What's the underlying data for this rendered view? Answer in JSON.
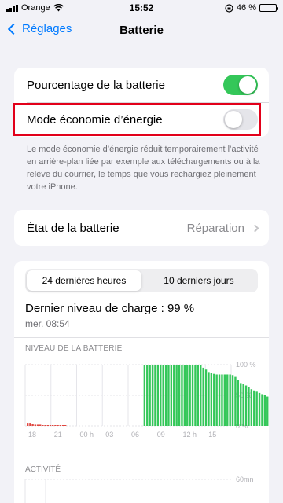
{
  "status_bar": {
    "carrier": "Orange",
    "time": "15:52",
    "battery_percent": "46 %",
    "battery_level": 0.46
  },
  "nav": {
    "back_label": "Réglages",
    "title": "Batterie"
  },
  "settings": {
    "battery_percentage": {
      "label": "Pourcentage de la batterie",
      "on": true
    },
    "low_power_mode": {
      "label": "Mode économie d’énergie",
      "on": false
    },
    "footnote": "Le mode économie d’énergie réduit temporairement l’activité en arrière-plan liée par exemple aux téléchargements ou à la relève du courrier, le temps que vous rechargiez pleinement votre iPhone."
  },
  "battery_state": {
    "label": "État de la batterie",
    "value": "Réparation"
  },
  "usage": {
    "tabs": [
      "24 dernières heures",
      "10 derniers jours"
    ],
    "active_tab": 0,
    "last_charge": "Dernier niveau de charge : 99 %",
    "last_charge_time": "mer. 08:54",
    "battery_level_label": "NIVEAU DE LA BATTERIE",
    "activity_label": "ACTIVITÉ",
    "activity_max_label": "60mn"
  },
  "colors": {
    "accent": "#007aff",
    "toggle_on": "#34c759",
    "highlight": "#e2001a",
    "charge_bar": "#34c759",
    "low_bar": "#e0463f"
  },
  "chart_data": {
    "type": "bar",
    "y_ticks": [
      "100 %",
      "50 %",
      "0 %"
    ],
    "ylim": [
      0,
      100
    ],
    "x_ticks": [
      "18",
      "21",
      "00 h",
      "03",
      "06",
      "09",
      "12 h",
      "15"
    ],
    "low_values": [
      5,
      5,
      3,
      2,
      2,
      2,
      1,
      1,
      1,
      1,
      1,
      1,
      1,
      1,
      1,
      1
    ],
    "charge_values": [
      100,
      100,
      100,
      100,
      100,
      100,
      100,
      100,
      100,
      100,
      100,
      100,
      100,
      100,
      100,
      100,
      100,
      100,
      100,
      100,
      100,
      100,
      95,
      92,
      88,
      86,
      85,
      84,
      84,
      84,
      84,
      84,
      84,
      83,
      80,
      75,
      70,
      68,
      66,
      64,
      60,
      58,
      56,
      54,
      52,
      50,
      48,
      46
    ]
  }
}
